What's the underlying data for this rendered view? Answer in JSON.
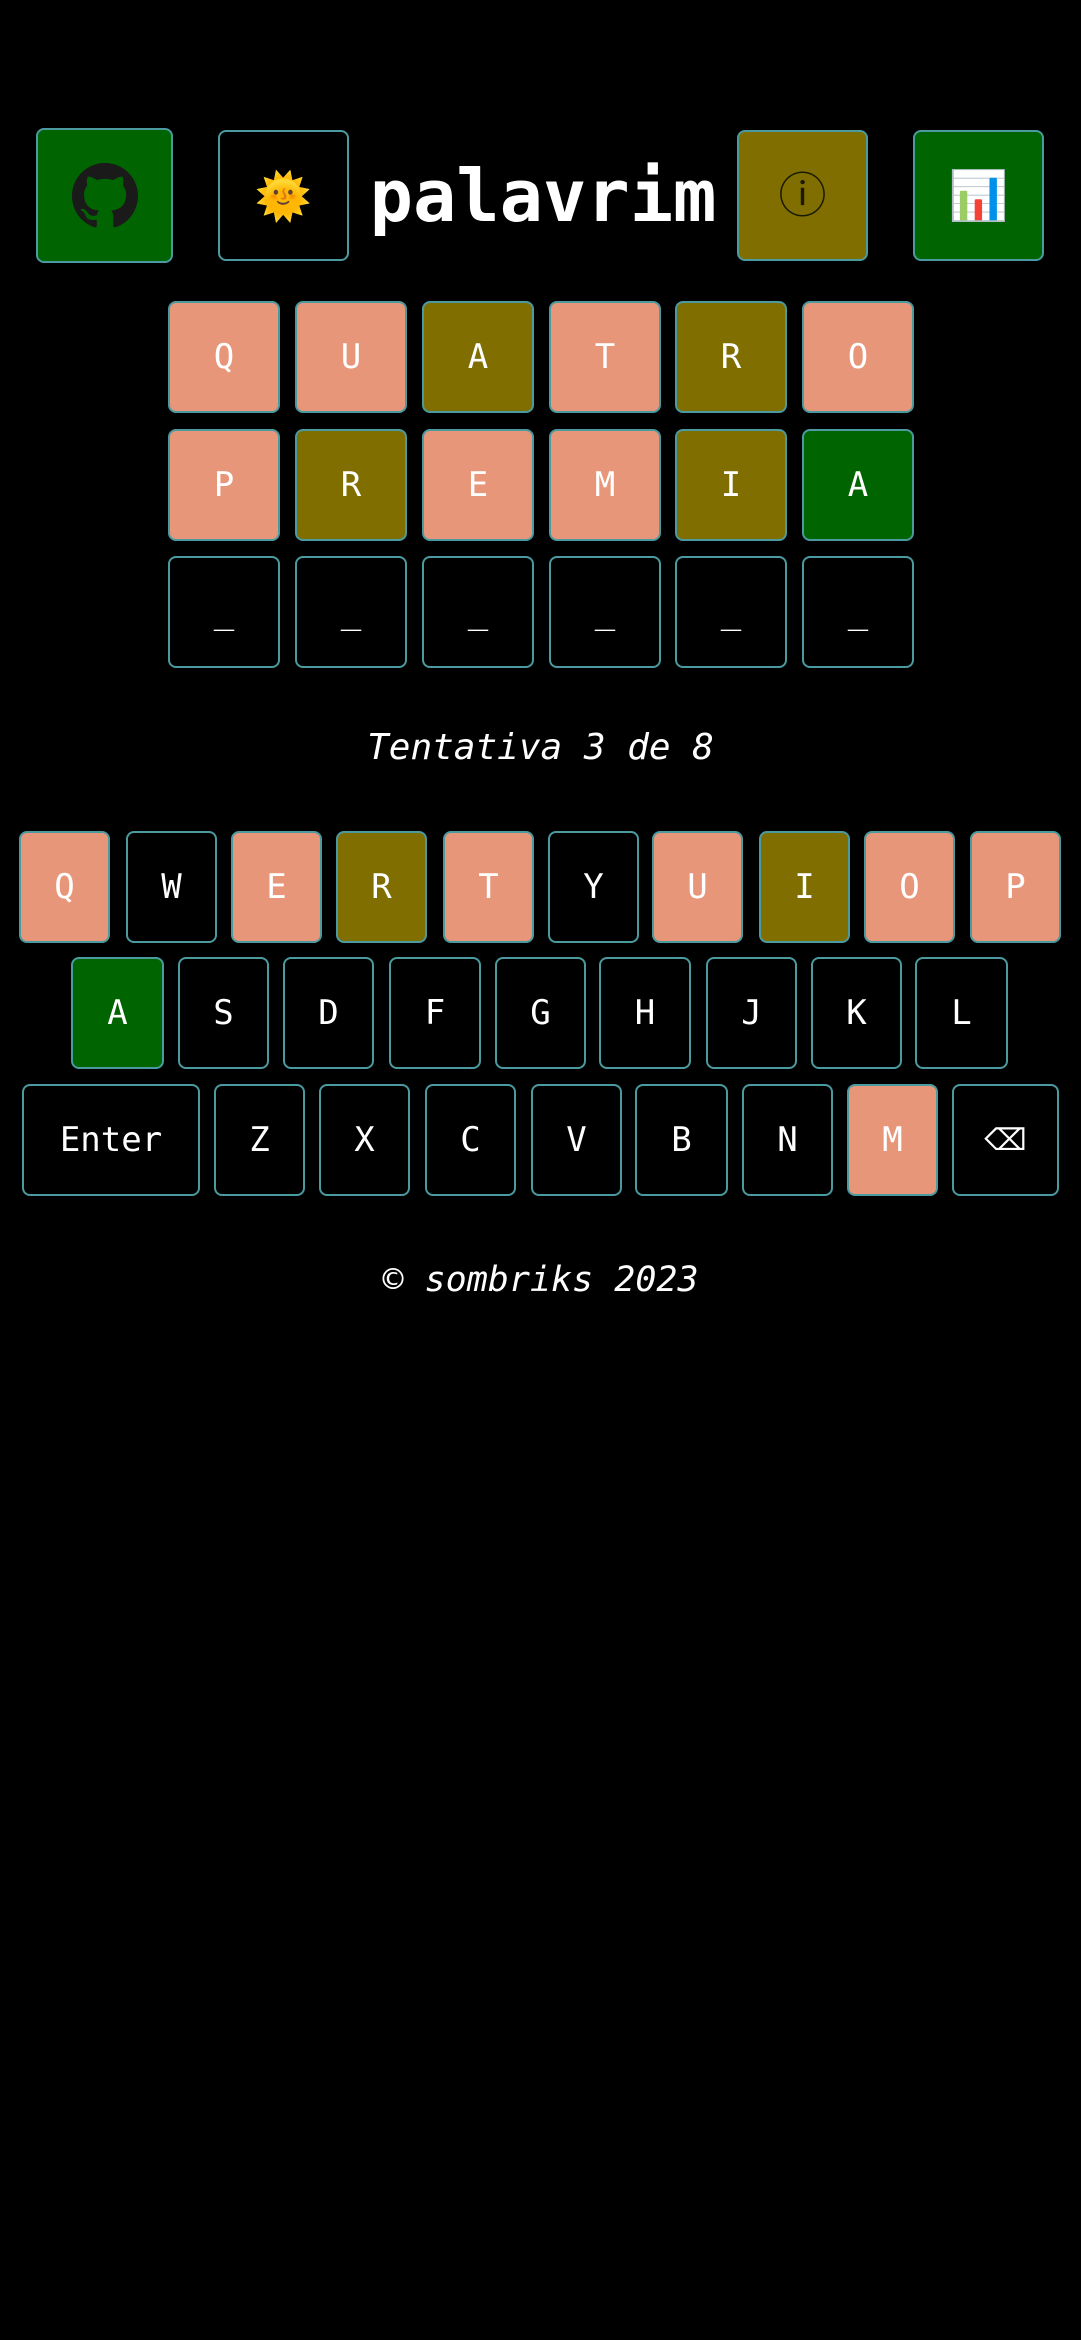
{
  "header": {
    "title": "palavrim",
    "github_icon": "github-icon",
    "theme_icon": "sun-icon",
    "theme_glyph": "🌞",
    "info_icon": "info-circle-icon",
    "info_glyph": "ⓘ",
    "stats_icon": "bar-chart-icon",
    "stats_glyph": "📊"
  },
  "board": {
    "rows": [
      [
        {
          "letter": "Q",
          "state": "absent"
        },
        {
          "letter": "U",
          "state": "absent"
        },
        {
          "letter": "A",
          "state": "present"
        },
        {
          "letter": "T",
          "state": "absent"
        },
        {
          "letter": "R",
          "state": "present"
        },
        {
          "letter": "O",
          "state": "absent"
        }
      ],
      [
        {
          "letter": "P",
          "state": "absent"
        },
        {
          "letter": "R",
          "state": "present"
        },
        {
          "letter": "E",
          "state": "absent"
        },
        {
          "letter": "M",
          "state": "absent"
        },
        {
          "letter": "I",
          "state": "present"
        },
        {
          "letter": "A",
          "state": "correct"
        }
      ],
      [
        {
          "letter": "_",
          "state": "empty"
        },
        {
          "letter": "_",
          "state": "empty"
        },
        {
          "letter": "_",
          "state": "empty"
        },
        {
          "letter": "_",
          "state": "empty"
        },
        {
          "letter": "_",
          "state": "empty"
        },
        {
          "letter": "_",
          "state": "empty"
        }
      ]
    ]
  },
  "status": {
    "attempt_text": "Tentativa 3 de 8"
  },
  "keyboard": {
    "rows": [
      [
        {
          "label": "Q",
          "state": "absent"
        },
        {
          "label": "W",
          "state": "unused"
        },
        {
          "label": "E",
          "state": "absent"
        },
        {
          "label": "R",
          "state": "present"
        },
        {
          "label": "T",
          "state": "absent"
        },
        {
          "label": "Y",
          "state": "unused"
        },
        {
          "label": "U",
          "state": "absent"
        },
        {
          "label": "I",
          "state": "present"
        },
        {
          "label": "O",
          "state": "absent"
        },
        {
          "label": "P",
          "state": "absent"
        }
      ],
      [
        {
          "label": "A",
          "state": "correct"
        },
        {
          "label": "S",
          "state": "unused"
        },
        {
          "label": "D",
          "state": "unused"
        },
        {
          "label": "F",
          "state": "unused"
        },
        {
          "label": "G",
          "state": "unused"
        },
        {
          "label": "H",
          "state": "unused"
        },
        {
          "label": "J",
          "state": "unused"
        },
        {
          "label": "K",
          "state": "unused"
        },
        {
          "label": "L",
          "state": "unused"
        }
      ],
      [
        {
          "label": "Enter",
          "state": "unused"
        },
        {
          "label": "Z",
          "state": "unused"
        },
        {
          "label": "X",
          "state": "unused"
        },
        {
          "label": "C",
          "state": "unused"
        },
        {
          "label": "V",
          "state": "unused"
        },
        {
          "label": "B",
          "state": "unused"
        },
        {
          "label": "N",
          "state": "unused"
        },
        {
          "label": "M",
          "state": "absent"
        },
        {
          "label": "⌫",
          "state": "unused"
        }
      ]
    ]
  },
  "footer": {
    "text": "© sombriks 2023"
  },
  "colors": {
    "background": "#000000",
    "absent": "#e8967a",
    "present": "#806f00",
    "correct": "#006400",
    "border": "#4a9aa0",
    "text": "#ffffff"
  }
}
